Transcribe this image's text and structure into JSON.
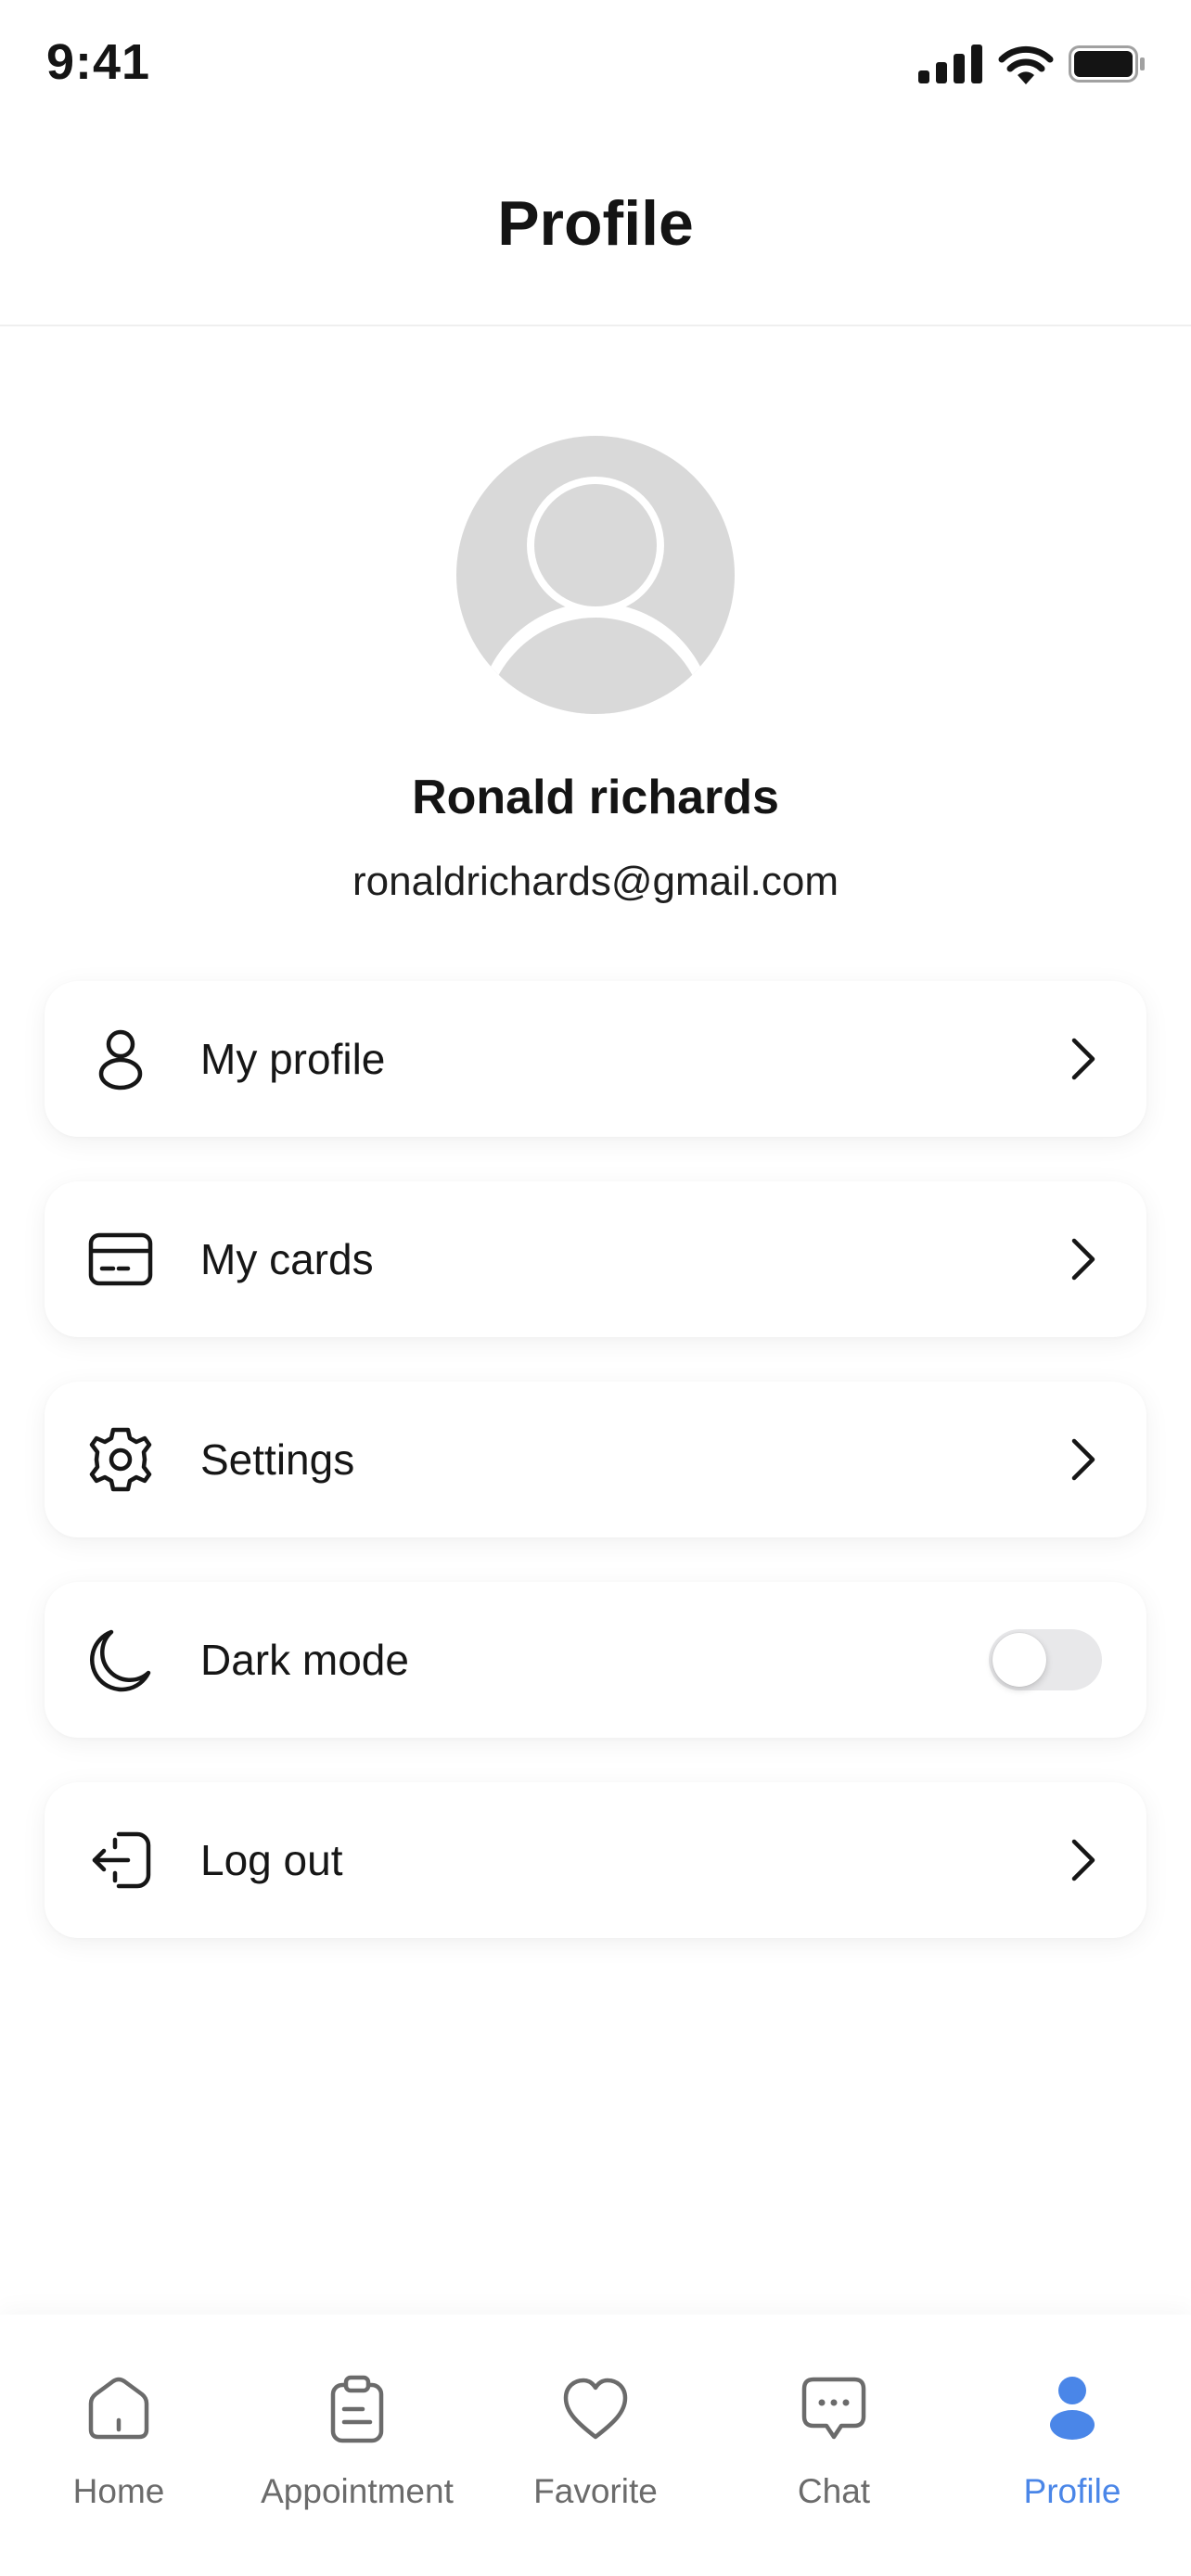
{
  "status_bar": {
    "time": "9:41"
  },
  "header": {
    "title": "Profile"
  },
  "user": {
    "name": "Ronald richards",
    "email": "ronaldrichards@gmail.com"
  },
  "menu": {
    "items": [
      {
        "label": "My profile",
        "icon": "person-icon"
      },
      {
        "label": "My cards",
        "icon": "card-icon"
      },
      {
        "label": "Settings",
        "icon": "gear-icon"
      },
      {
        "label": "Dark mode",
        "icon": "moon-icon",
        "toggle_on": false
      },
      {
        "label": "Log out",
        "icon": "logout-icon"
      }
    ]
  },
  "tab_bar": {
    "active": "Profile",
    "tabs": [
      {
        "label": "Home",
        "icon": "home-icon"
      },
      {
        "label": "Appointment",
        "icon": "clipboard-icon"
      },
      {
        "label": "Favorite",
        "icon": "heart-icon"
      },
      {
        "label": "Chat",
        "icon": "chat-bubble-icon"
      },
      {
        "label": "Profile",
        "icon": "profile-icon"
      }
    ]
  },
  "colors": {
    "accent": "#4a86e8",
    "text": "#141414",
    "inactive_tab": "#6b6b6b",
    "avatar_placeholder": "#d9d9d9",
    "toggle_off": "#e8e8ea"
  }
}
